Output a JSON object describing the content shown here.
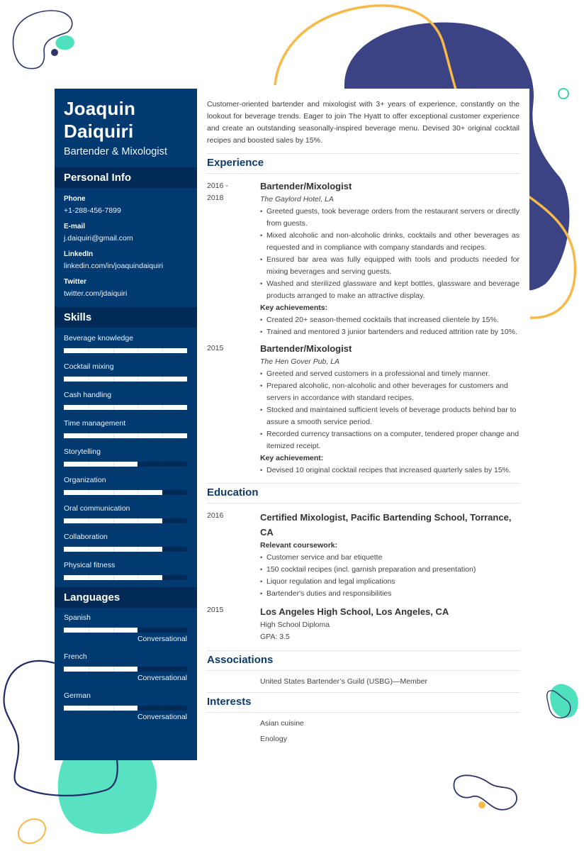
{
  "header": {
    "name_line1": "Joaquin",
    "name_line2": "Daiquiri",
    "title": "Bartender & Mixologist"
  },
  "personal_info": {
    "heading": "Personal Info",
    "items": [
      {
        "label": "Phone",
        "value": "+1-288-456-7899"
      },
      {
        "label": "E-mail",
        "value": "j.daiquiri@gmail.com"
      },
      {
        "label": "LinkedIn",
        "value": "linkedin.com/in/joaquindaiquiri"
      },
      {
        "label": "Twitter",
        "value": "twitter.com/jdaiquiri"
      }
    ]
  },
  "skills": {
    "heading": "Skills",
    "scale_max": 5,
    "items": [
      {
        "name": "Beverage knowledge",
        "level": 5
      },
      {
        "name": "Cocktail mixing",
        "level": 5
      },
      {
        "name": "Cash handling",
        "level": 5
      },
      {
        "name": "Time management",
        "level": 5
      },
      {
        "name": "Storytelling",
        "level": 3
      },
      {
        "name": "Organization",
        "level": 4
      },
      {
        "name": "Oral communication",
        "level": 4
      },
      {
        "name": "Collaboration",
        "level": 4
      },
      {
        "name": "Physical fitness",
        "level": 4
      }
    ]
  },
  "languages": {
    "heading": "Languages",
    "scale_max": 5,
    "items": [
      {
        "name": "Spanish",
        "level": 3,
        "level_label": "Conversational"
      },
      {
        "name": "French",
        "level": 3,
        "level_label": "Conversational"
      },
      {
        "name": "German",
        "level": 3,
        "level_label": "Conversational"
      }
    ]
  },
  "summary": "Customer-oriented bartender and mixologist with 3+ years of experience, constantly on the lookout for beverage trends. Eager to join The Hyatt to offer exceptional customer experience and create an outstanding seasonally-inspired beverage menu. Devised 30+ original cocktail recipes and boosted sales by 15%.",
  "experience": {
    "heading": "Experience",
    "jobs": [
      {
        "date_line1": "2016 -",
        "date_line2": "2018",
        "title": "Bartender/Mixologist",
        "company": "The Gaylord Hotel, LA",
        "duties": [
          "Greeted guests, took beverage orders from the restaurant servers or directly from guests.",
          "Mixed alcoholic and non-alcoholic drinks, cocktails and other beverages as requested and in compliance with company standards and recipes.",
          "Ensured bar area was fully equipped with tools and products needed for mixing beverages and serving guests.",
          "Washed and sterilized glassware and kept bottles, glassware and beverage products arranged to make an attractive display."
        ],
        "achievements_heading": "Key achievements:",
        "achievements": [
          "Created 20+ season-themed cocktails that increased clientele by 15%.",
          "Trained and mentored 3 junior bartenders and reduced attrition rate by 10%."
        ]
      },
      {
        "date_line1": "2015",
        "date_line2": "",
        "title": "Bartender/Mixologist",
        "company": "The Hen Gover Pub, LA",
        "duties": [
          "Greeted and served customers in a professional and timely manner.",
          "Prepared alcoholic, non-alcoholic and other beverages for customers and servers in accordance with standard recipes.",
          "Stocked and maintained sufficient levels of beverage products behind bar to assure a smooth service period.",
          "Recorded currency transactions on a computer, tendered proper change and itemized receipt."
        ],
        "achievements_heading": "Key achievement:",
        "achievements": [
          "Devised 10 original cocktail recipes that increased quarterly sales by 15%."
        ]
      }
    ]
  },
  "education": {
    "heading": "Education",
    "entries": [
      {
        "date": "2016",
        "title": "Certified Mixologist, Pacific Bartending School, Torrance, CA",
        "coursework_heading": "Relevant coursework:",
        "coursework": [
          "Customer service and bar etiquette",
          "150 cocktail recipes (incl. garnish preparation and presentation)",
          "Liquor regulation and legal implications",
          "Bartender's duties and responsibilities"
        ]
      },
      {
        "date": "2015",
        "title": "Los Angeles High School, Los Angeles, CA",
        "line1": "High School Diploma",
        "line2": "GPA: 3.5"
      }
    ]
  },
  "associations": {
    "heading": "Associations",
    "items": [
      "United States Bartender’s Guild (USBG)—Member"
    ]
  },
  "interests": {
    "heading": "Interests",
    "items": [
      "Asian cuisine",
      "Enology"
    ]
  },
  "colors": {
    "sidebar": "#003a71",
    "sidebar_header": "#012b56",
    "heading_blue": "#0e3b69",
    "navy_blob": "#3b4384",
    "mint": "#4fe0bd",
    "orange": "#f7b948"
  }
}
